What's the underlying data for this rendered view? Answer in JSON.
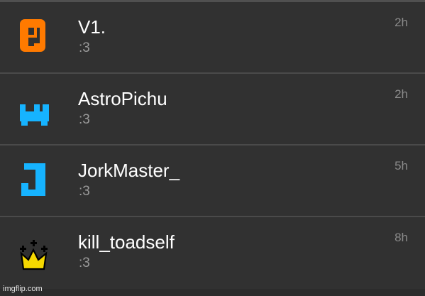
{
  "chat_list": {
    "items": [
      {
        "name": "V1.",
        "message": ":3",
        "time": "2h",
        "avatar_icon": "orange-p-icon",
        "avatar_color": "#ff7a00"
      },
      {
        "name": "AstroPichu",
        "message": ":3",
        "time": "2h",
        "avatar_icon": "blue-crown-icon",
        "avatar_color": "#16b3ff"
      },
      {
        "name": "JorkMaster_",
        "message": ":3",
        "time": "5h",
        "avatar_icon": "blue-j-icon",
        "avatar_color": "#16b3ff"
      },
      {
        "name": "kill_toadself",
        "message": ":3",
        "time": "8h",
        "avatar_icon": "gold-crown-icon",
        "avatar_color": "#f5d800"
      }
    ]
  },
  "watermark": {
    "text": "imgflip.com"
  },
  "colors": {
    "background": "#2c2c2c",
    "row_background": "#313131",
    "separator": "#4a4a4a",
    "name_text": "#ffffff",
    "message_text": "#9a9a9a",
    "time_text": "#8a8a8a"
  }
}
